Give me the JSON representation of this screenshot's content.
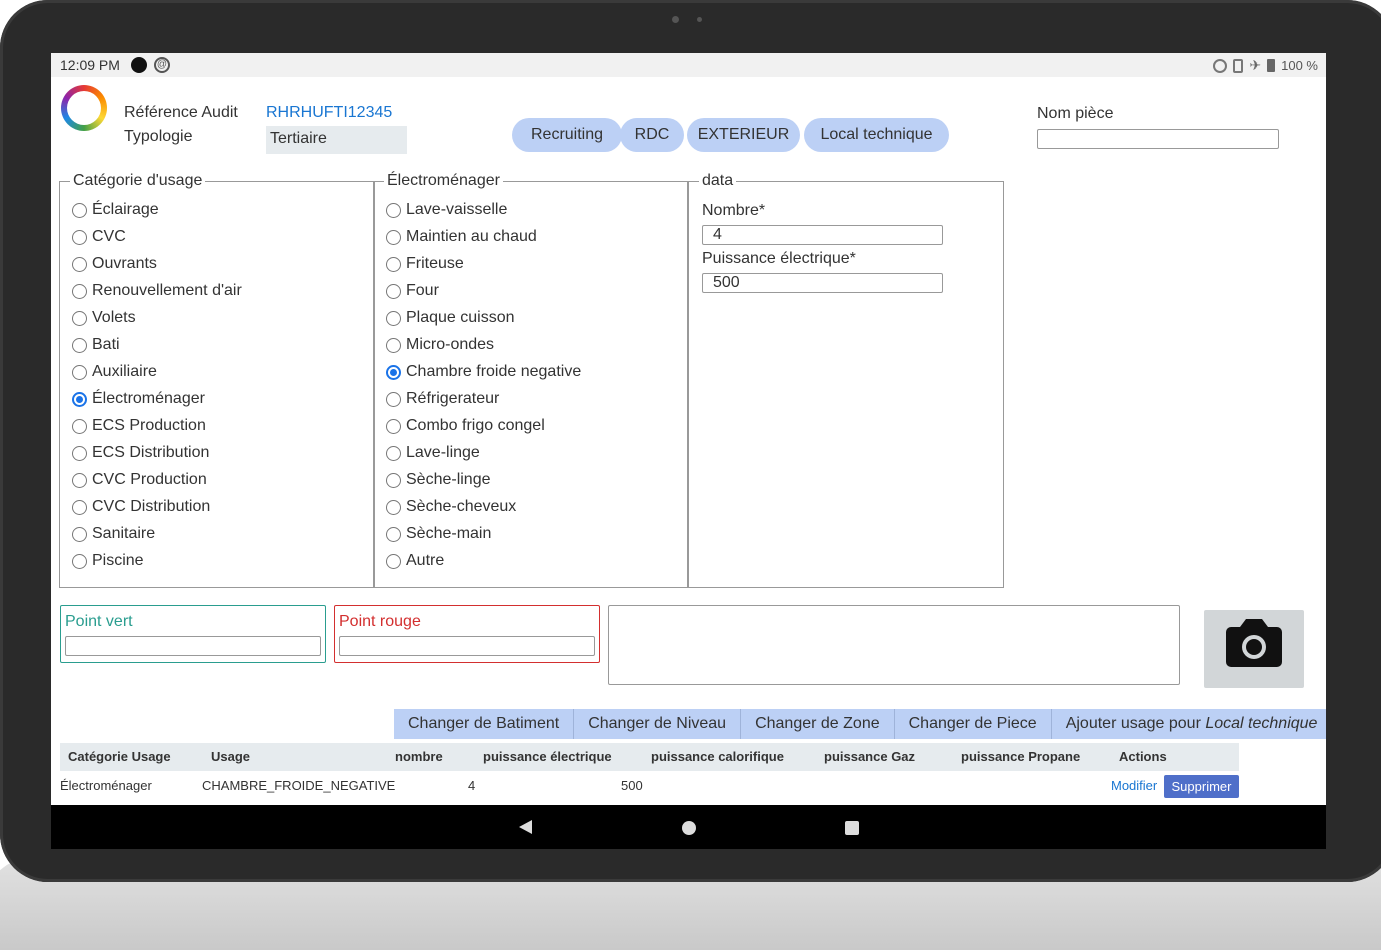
{
  "status": {
    "time": "12:09 PM",
    "battery": "100 %"
  },
  "header": {
    "reference_label": "Référence Audit",
    "reference_value": "RHRHUFTI12345",
    "typology_label": "Typologie",
    "typology_value": "Tertiaire",
    "nom_piece_label": "Nom pièce",
    "nom_piece_value": ""
  },
  "breadcrumb": [
    "Recruiting",
    "RDC",
    "EXTERIEUR",
    "Local technique"
  ],
  "categorie": {
    "legend": "Catégorie d'usage",
    "selected": "Électroménager",
    "options": [
      "Éclairage",
      "CVC",
      "Ouvrants",
      "Renouvellement d'air",
      "Volets",
      "Bati",
      "Auxiliaire",
      "Électroménager",
      "ECS Production",
      "ECS Distribution",
      "CVC Production",
      "CVC Distribution",
      "Sanitaire",
      "Piscine"
    ]
  },
  "electromenager": {
    "legend": "Électroménager",
    "selected": "Chambre froide negative",
    "options": [
      "Lave-vaisselle",
      "Maintien au chaud",
      "Friteuse",
      "Four",
      "Plaque cuisson",
      "Micro-ondes",
      "Chambre froide negative",
      "Réfrigerateur",
      "Combo frigo congel",
      "Lave-linge",
      "Sèche-linge",
      "Sèche-cheveux",
      "Sèche-main",
      "Autre"
    ]
  },
  "data_panel": {
    "legend": "data",
    "nombre_label": "Nombre*",
    "nombre_value": "4",
    "puissance_label": "Puissance électrique*",
    "puissance_value": "500"
  },
  "points": {
    "vert_label": "Point vert",
    "vert_color": "#2a9d8f",
    "rouge_label": "Point rouge",
    "rouge_color": "#d32f2f"
  },
  "actions": {
    "batiment": "Changer de Batiment",
    "niveau": "Changer de Niveau",
    "zone": "Changer de Zone",
    "piece": "Changer de Piece",
    "ajouter_prefix": "Ajouter usage pour ",
    "ajouter_target": "Local technique"
  },
  "table": {
    "headers": [
      "Catégorie Usage",
      "Usage",
      "nombre",
      "puissance électrique",
      "puissance calorifique",
      "puissance Gaz",
      "puissance Propane",
      "Actions"
    ],
    "rows": [
      {
        "categorie": "Électroménager",
        "usage": "CHAMBRE_FROIDE_NEGATIVE",
        "nombre": "4",
        "puissance_electrique": "500",
        "modifier": "Modifier",
        "supprimer": "Supprimer"
      }
    ]
  },
  "colors": {
    "accent": "#bcd0f5",
    "link": "#1976d2",
    "radio": "#1a73e8",
    "delete": "#4f6fc9"
  },
  "icons": [
    "camera-icon",
    "back-icon",
    "home-icon",
    "recents-icon"
  ]
}
